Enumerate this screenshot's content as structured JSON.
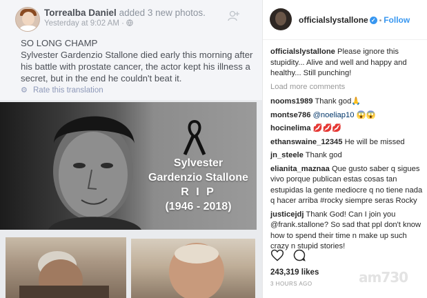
{
  "facebook": {
    "author": "Torrealba Daniel",
    "action": "added 3 new photos.",
    "timestamp": "Yesterday at 9:02 AM",
    "audience_icon": "globe-icon",
    "add_friend_icon": "add-friend-icon",
    "post_heading": "SO LONG CHAMP",
    "post_body": "Sylvester Gardenzio Stallone died early this morning after his battle with prostate cancer, the actor kept his illness a secret, but in the end he couldn't beat it.",
    "translate_label": "Rate this translation",
    "memorial": {
      "line1": "Sylvester",
      "line2": "Gardenzio Stallone",
      "line3": "R I P",
      "line4": "(1946 - 2018)"
    }
  },
  "instagram": {
    "username": "officialslystallone",
    "follow_label": "Follow",
    "accent": "#3897f0",
    "caption_user": "officialslystallone",
    "caption_text": "Please ignore this stupidity... Alive and well and happy and healthy... Still punching!",
    "load_more": "Load more comments",
    "comments": [
      {
        "user": "nooms1989",
        "text": "Thank god🙏"
      },
      {
        "user": "montse786",
        "text": "@noeliap10 😱😱"
      },
      {
        "user": "hocinelima",
        "text": "💋💋💋"
      },
      {
        "user": "ethanswaine_12345",
        "text": "He will be missed"
      },
      {
        "user": "jn_steele",
        "text": "Thank god"
      },
      {
        "user": "elianita_maznaa",
        "text": "Que gusto saber q sigues vivo porque publican estas cosas tan estupidas la gente mediocre q no tiene nada q hacer arriba #rocky siempre seras Rocky"
      },
      {
        "user": "justicejdj",
        "text": "Thank God! Can I join you @frank.stallone? So sad that ppl don't know how to spend their time n make up such crazy n stupid stories!"
      }
    ],
    "likes": "243,319 likes",
    "time": "3 HOURS AGO"
  },
  "watermark": "am730"
}
